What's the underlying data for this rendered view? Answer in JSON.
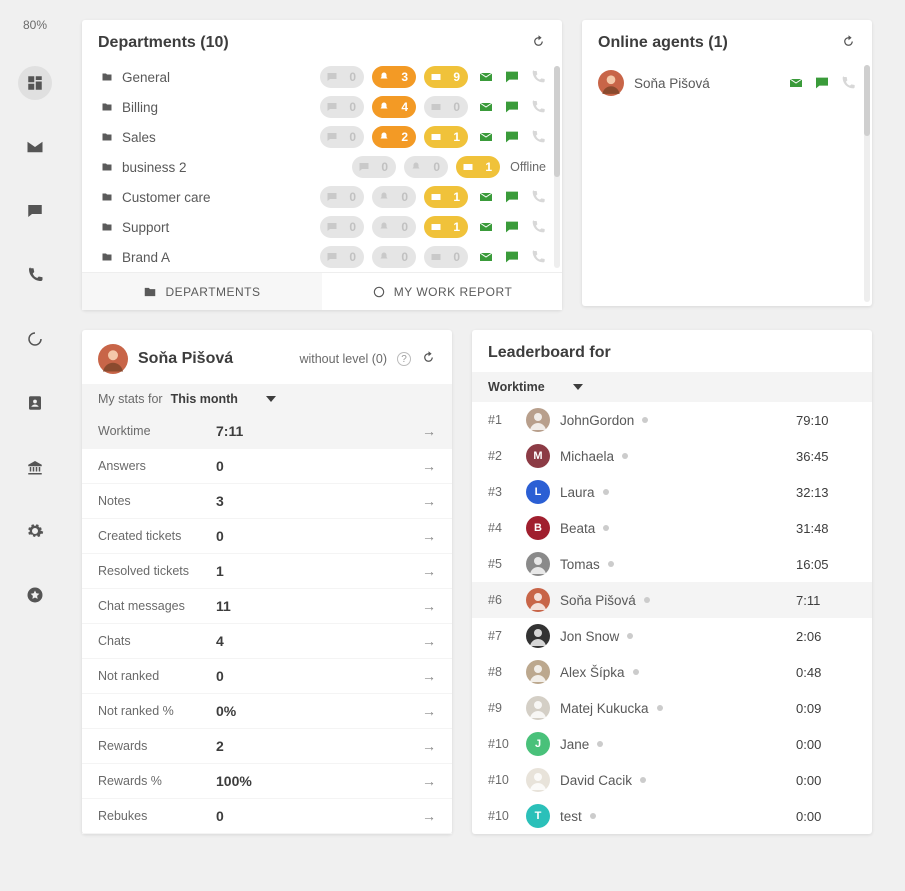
{
  "zoom_label": "80%",
  "sidebar": {
    "items": [
      {
        "name": "dashboard",
        "active": true
      },
      {
        "name": "mail",
        "active": false
      },
      {
        "name": "chat",
        "active": false
      },
      {
        "name": "phone",
        "active": false
      },
      {
        "name": "loading",
        "active": false
      },
      {
        "name": "contacts",
        "active": false
      },
      {
        "name": "bank",
        "active": false
      },
      {
        "name": "settings",
        "active": false
      },
      {
        "name": "star",
        "active": false
      }
    ]
  },
  "departments": {
    "title": "Departments (10)",
    "rows": [
      {
        "name": "General",
        "p1": {
          "val": 0,
          "cls": "grey"
        },
        "p2": {
          "val": 3,
          "cls": "orange"
        },
        "p3": {
          "val": 9,
          "cls": "yellow"
        },
        "offline": false
      },
      {
        "name": "Billing",
        "p1": {
          "val": 0,
          "cls": "grey"
        },
        "p2": {
          "val": 4,
          "cls": "orange"
        },
        "p3": {
          "val": 0,
          "cls": "grey"
        },
        "offline": false
      },
      {
        "name": "Sales",
        "p1": {
          "val": 0,
          "cls": "grey"
        },
        "p2": {
          "val": 2,
          "cls": "orange"
        },
        "p3": {
          "val": 1,
          "cls": "yellow"
        },
        "offline": false
      },
      {
        "name": "business 2",
        "p1": {
          "val": 0,
          "cls": "grey"
        },
        "p2": {
          "val": 0,
          "cls": "grey"
        },
        "p3": {
          "val": 1,
          "cls": "yellow"
        },
        "offline": true
      },
      {
        "name": "Customer care",
        "p1": {
          "val": 0,
          "cls": "grey"
        },
        "p2": {
          "val": 0,
          "cls": "grey"
        },
        "p3": {
          "val": 1,
          "cls": "yellow"
        },
        "offline": false
      },
      {
        "name": "Support",
        "p1": {
          "val": 0,
          "cls": "grey"
        },
        "p2": {
          "val": 0,
          "cls": "grey"
        },
        "p3": {
          "val": 1,
          "cls": "yellow"
        },
        "offline": false
      },
      {
        "name": "Brand A",
        "p1": {
          "val": 0,
          "cls": "grey"
        },
        "p2": {
          "val": 0,
          "cls": "grey"
        },
        "p3": {
          "val": 0,
          "cls": "grey"
        },
        "offline": false
      }
    ],
    "offline_label": "Offline",
    "tabs": {
      "departments": "DEPARTMENTS",
      "report": "MY WORK REPORT"
    }
  },
  "agents": {
    "title": "Online agents (1)",
    "rows": [
      {
        "name": "Soňa Pišová",
        "avatar_bg": "#c86548",
        "initial": ""
      }
    ]
  },
  "profile": {
    "name": "Soňa Pišová",
    "level": "without level (0)",
    "filter_label": "My stats for",
    "filter_value": "This month",
    "stats": [
      {
        "label": "Worktime",
        "value": "7:11",
        "sel": true
      },
      {
        "label": "Answers",
        "value": "0"
      },
      {
        "label": "Notes",
        "value": "3"
      },
      {
        "label": "Created tickets",
        "value": "0"
      },
      {
        "label": "Resolved tickets",
        "value": "1"
      },
      {
        "label": "Chat messages",
        "value": "11"
      },
      {
        "label": "Chats",
        "value": "4"
      },
      {
        "label": "Not ranked",
        "value": "0"
      },
      {
        "label": "Not ranked %",
        "value": "0%"
      },
      {
        "label": "Rewards",
        "value": "2"
      },
      {
        "label": "Rewards %",
        "value": "100%"
      },
      {
        "label": "Rebukes",
        "value": "0"
      }
    ]
  },
  "leaderboard": {
    "title": "Leaderboard for",
    "filter_value": "Worktime",
    "rows": [
      {
        "rank": "#1",
        "name": "JohnGordon",
        "value": "79:10",
        "avatar_bg": "#b89f8c",
        "initial": ""
      },
      {
        "rank": "#2",
        "name": "Michaela",
        "value": "36:45",
        "avatar_bg": "#8c3b45",
        "initial": "M"
      },
      {
        "rank": "#3",
        "name": "Laura",
        "value": "32:13",
        "avatar_bg": "#2b5fd4",
        "initial": "L"
      },
      {
        "rank": "#4",
        "name": "Beata",
        "value": "31:48",
        "avatar_bg": "#a01f2e",
        "initial": "B"
      },
      {
        "rank": "#5",
        "name": "Tomas",
        "value": "16:05",
        "avatar_bg": "#8a8a8a",
        "initial": ""
      },
      {
        "rank": "#6",
        "name": "Soňa Pišová",
        "value": "7:11",
        "avatar_bg": "#c86548",
        "initial": "",
        "sel": true
      },
      {
        "rank": "#7",
        "name": "Jon Snow",
        "value": "2:06",
        "avatar_bg": "#333333",
        "initial": ""
      },
      {
        "rank": "#8",
        "name": "Alex Šípka",
        "value": "0:48",
        "avatar_bg": "#bca88e",
        "initial": ""
      },
      {
        "rank": "#9",
        "name": "Matej Kukucka",
        "value": "0:09",
        "avatar_bg": "#d4cfc6",
        "initial": ""
      },
      {
        "rank": "#10",
        "name": "Jane",
        "value": "0:00",
        "avatar_bg": "#49c17a",
        "initial": "J"
      },
      {
        "rank": "#10",
        "name": "David Cacik",
        "value": "0:00",
        "avatar_bg": "#e8e3da",
        "initial": ""
      },
      {
        "rank": "#10",
        "name": "test",
        "value": "0:00",
        "avatar_bg": "#2bc0b9",
        "initial": "T"
      }
    ]
  }
}
